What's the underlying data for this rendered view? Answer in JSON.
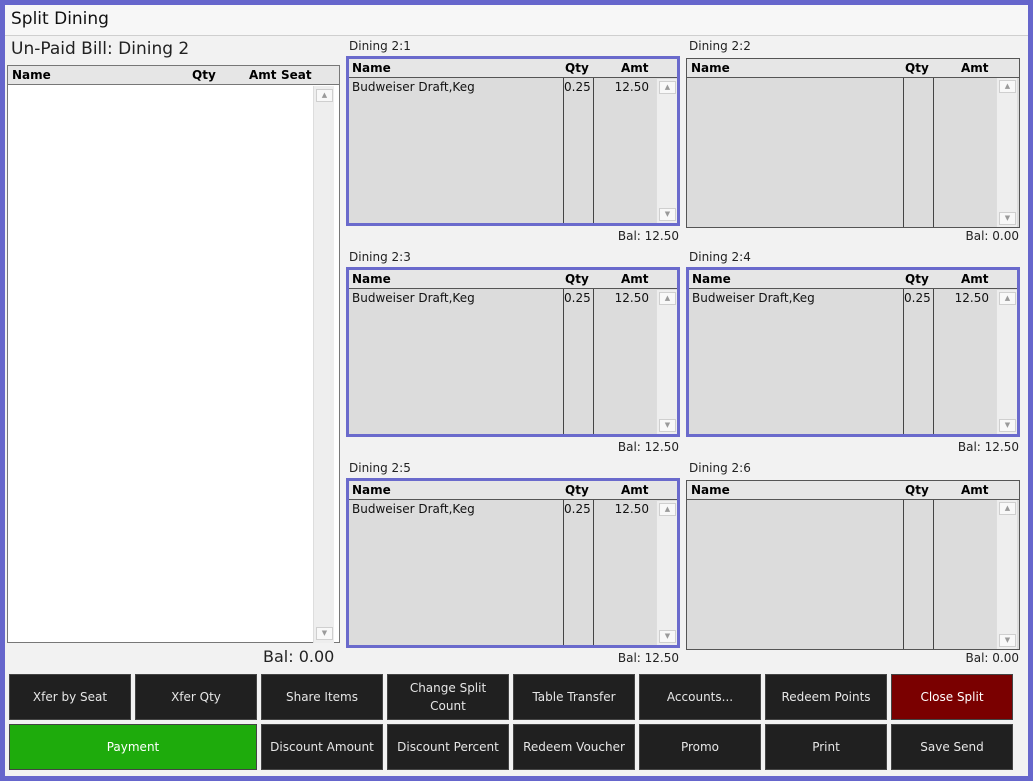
{
  "window": {
    "title": "Split Dining"
  },
  "unpaid": {
    "title": "Un-Paid Bill: Dining 2",
    "columns": {
      "name": "Name",
      "qty": "Qty",
      "amt": "Amt",
      "seat": "Seat"
    },
    "balance": "Bal: 0.00"
  },
  "columns": {
    "name": "Name",
    "qty": "Qty",
    "amt": "Amt"
  },
  "splits": [
    {
      "label": "Dining 2:1",
      "items": [
        {
          "name": "Budweiser Draft,Keg",
          "qty": "0.25",
          "amt": "12.50"
        }
      ],
      "balance": "Bal: 12.50"
    },
    {
      "label": "Dining 2:2",
      "items": [],
      "balance": "Bal: 0.00"
    },
    {
      "label": "Dining 2:3",
      "items": [
        {
          "name": "Budweiser Draft,Keg",
          "qty": "0.25",
          "amt": "12.50"
        }
      ],
      "balance": "Bal: 12.50"
    },
    {
      "label": "Dining 2:4",
      "items": [
        {
          "name": "Budweiser Draft,Keg",
          "qty": "0.25",
          "amt": "12.50"
        }
      ],
      "balance": "Bal: 12.50"
    },
    {
      "label": "Dining 2:5",
      "items": [
        {
          "name": "Budweiser Draft,Keg",
          "qty": "0.25",
          "amt": "12.50"
        }
      ],
      "balance": "Bal: 12.50"
    },
    {
      "label": "Dining 2:6",
      "items": [],
      "balance": "Bal: 0.00"
    }
  ],
  "scroll_icons": {
    "up": "▲",
    "down": "▼"
  },
  "buttons": {
    "xfer_by_seat": "Xfer by Seat",
    "xfer_qty": "Xfer Qty",
    "share_items": "Share Items",
    "change_split_count": "Change Split Count",
    "table_transfer": "Table Transfer",
    "accounts": "Accounts...",
    "redeem_points": "Redeem Points",
    "close_split": "Close Split",
    "payment": "Payment",
    "discount_amount": "Discount Amount",
    "discount_percent": "Discount Percent",
    "redeem_voucher": "Redeem Voucher",
    "promo": "Promo",
    "print": "Print",
    "save_send": "Save Send"
  },
  "colors": {
    "frame": "#6666cc",
    "active_border": "#6a6acc",
    "payment": "#1eab0c",
    "close_split": "#7a0000",
    "button": "#202020"
  }
}
